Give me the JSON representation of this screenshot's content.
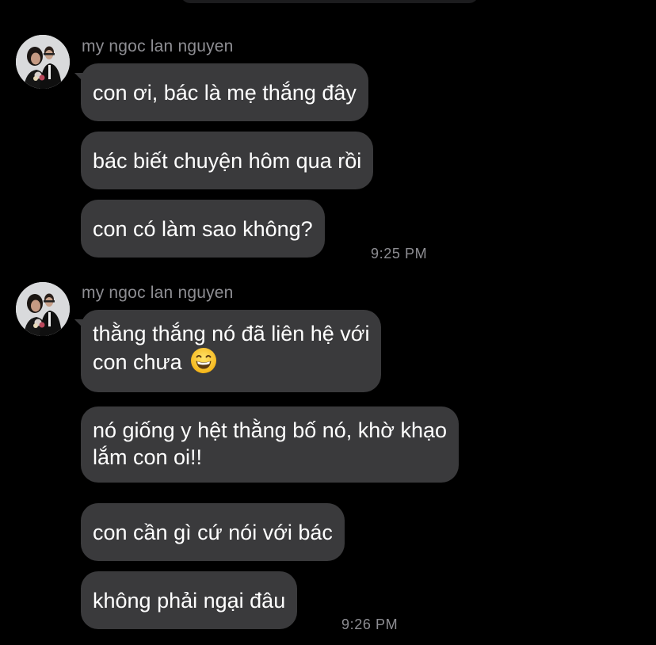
{
  "conversation": {
    "groups": [
      {
        "sender_name": "my ngoc lan nguyen",
        "messages": [
          {
            "lines": [
              "con ơi, bác là mẹ thắng đây"
            ]
          },
          {
            "lines": [
              "bác biết chuyện hôm qua rồi"
            ]
          },
          {
            "lines": [
              "con có làm sao không?"
            ]
          }
        ],
        "timestamp": "9:25 PM"
      },
      {
        "sender_name": "my ngoc lan nguyen",
        "messages": [
          {
            "lines": [
              "thằng thắng nó đã liên hệ với",
              "con chưa"
            ],
            "emoji": "grinning-face-emoji"
          },
          {
            "lines": [
              "nó giống y hệt thằng bố nó, khờ khạo",
              "lắm con oi!!"
            ]
          },
          {
            "lines": [
              "con cần gì cứ nói với bác"
            ]
          },
          {
            "lines": [
              "không phải ngại đâu"
            ]
          }
        ],
        "timestamp": "9:26 PM"
      }
    ]
  },
  "colors": {
    "background": "#000000",
    "bubble": "#3a3a3c",
    "message_text": "#ffffff",
    "meta_text": "#8e8e93"
  }
}
